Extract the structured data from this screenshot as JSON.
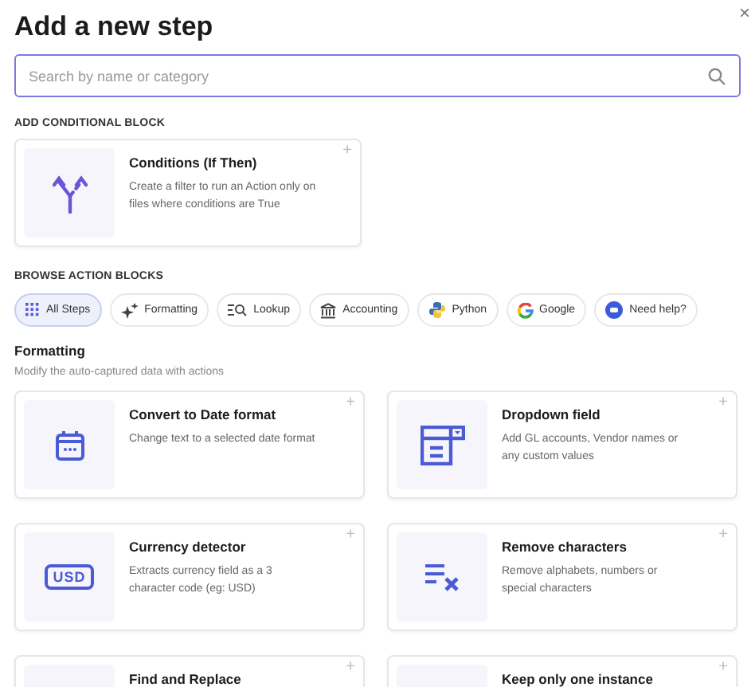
{
  "dialog": {
    "title": "Add a new step",
    "close": "×"
  },
  "search": {
    "placeholder": "Search by name or category"
  },
  "conditional": {
    "heading": "ADD CONDITIONAL BLOCK",
    "card": {
      "title": "Conditions (If Then)",
      "description": "Create a filter to run an Action only on files where conditions are True",
      "add": "+"
    }
  },
  "browse": {
    "heading": "BROWSE ACTION BLOCKS",
    "chips": [
      {
        "label": "All Steps",
        "selected": true
      },
      {
        "label": "Formatting",
        "selected": false
      },
      {
        "label": "Lookup",
        "selected": false
      },
      {
        "label": "Accounting",
        "selected": false
      },
      {
        "label": "Python",
        "selected": false
      },
      {
        "label": "Google",
        "selected": false
      },
      {
        "label": "Need help?",
        "selected": false
      }
    ]
  },
  "section": {
    "title": "Formatting",
    "subtitle": "Modify the auto-captured data with actions",
    "cards": [
      {
        "title": "Convert to Date format",
        "description": "Change text to a selected date format",
        "add": "+"
      },
      {
        "title": "Dropdown field",
        "description": "Add GL accounts, Vendor names or any custom values",
        "add": "+"
      },
      {
        "icon_text": "USD",
        "title": "Currency detector",
        "description": "Extracts currency field as a 3 character code (eg: USD)",
        "add": "+"
      },
      {
        "title": "Remove characters",
        "description": "Remove alphabets, numbers or special characters",
        "add": "+"
      },
      {
        "title": "Find and Replace",
        "add": "+"
      },
      {
        "title": "Keep only one instance",
        "add": "+"
      }
    ]
  }
}
